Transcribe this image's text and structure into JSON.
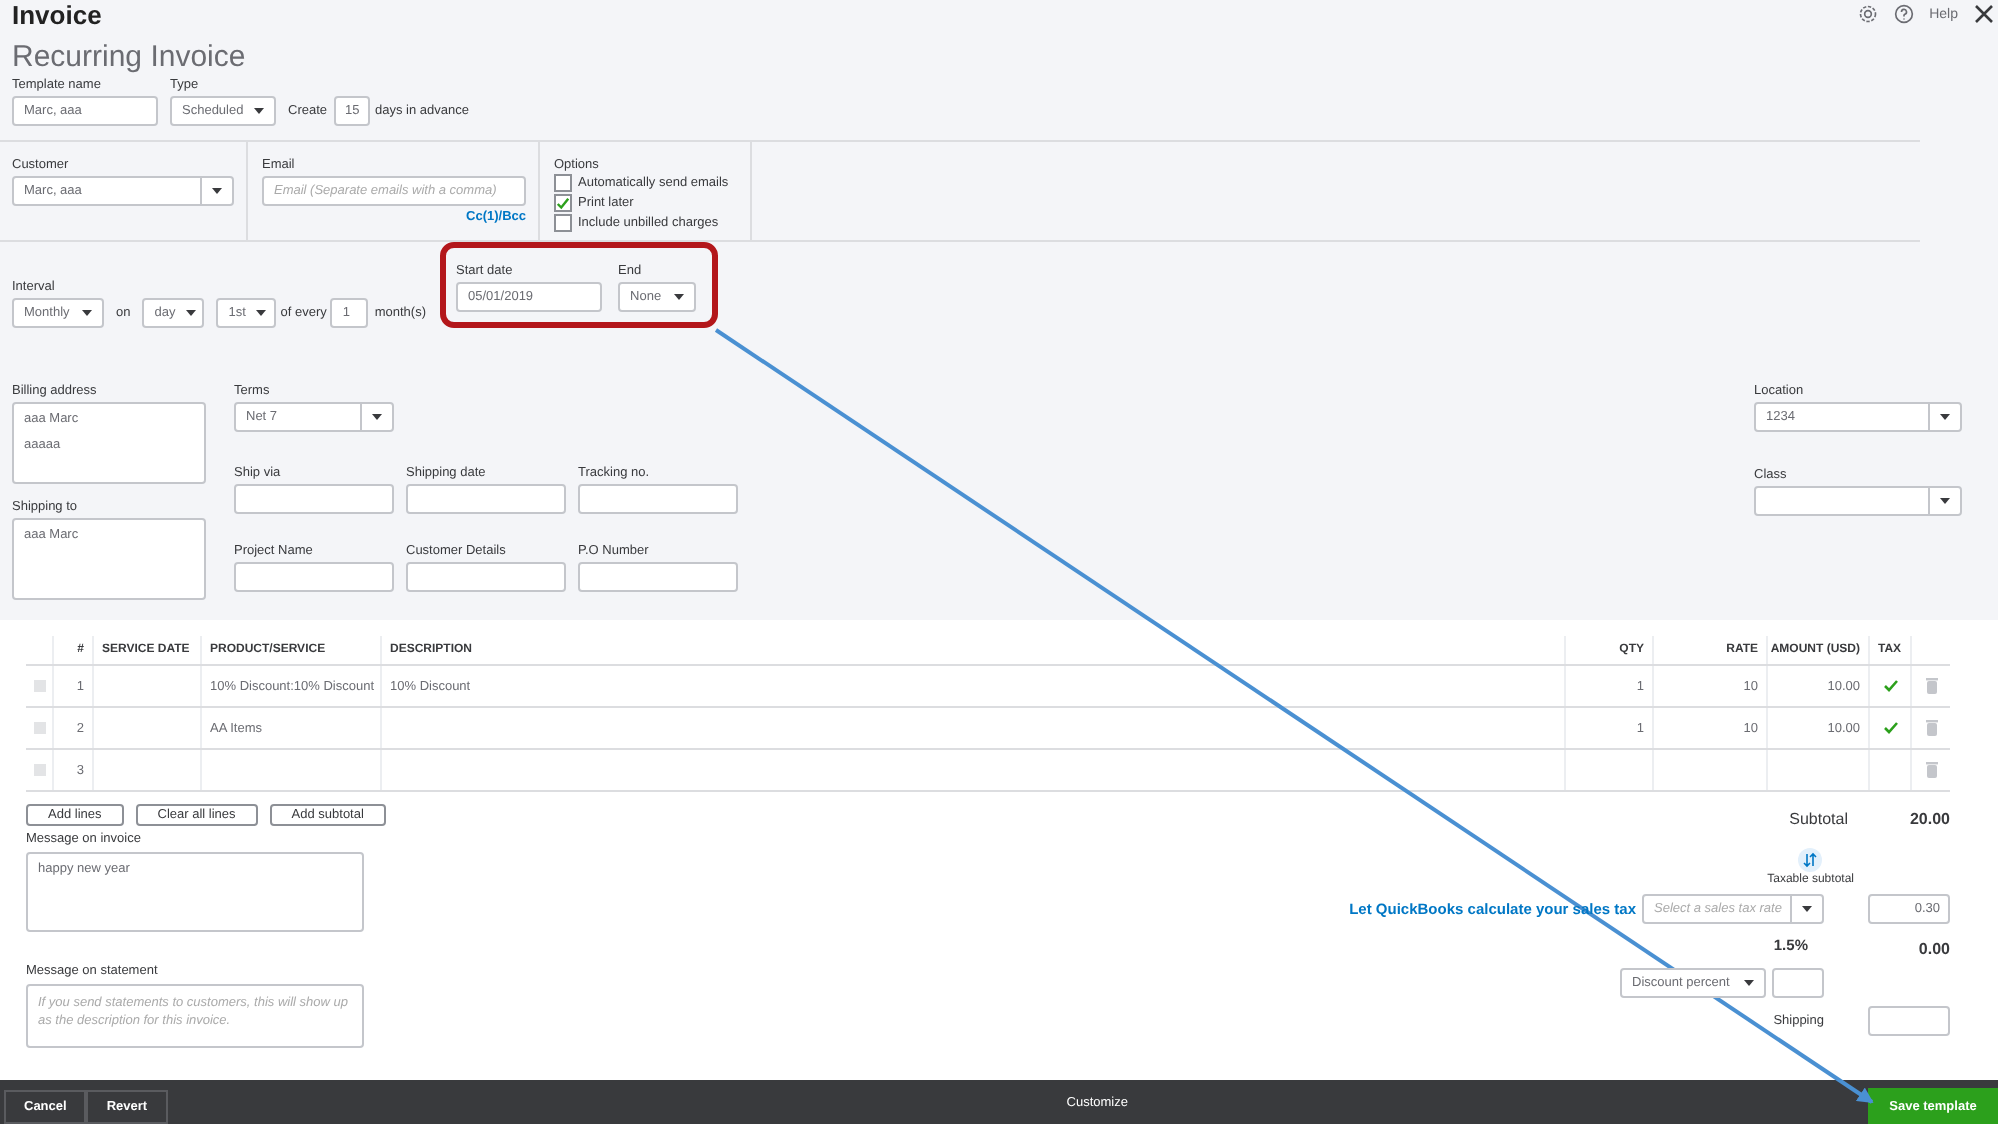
{
  "header": {
    "title": "Invoice",
    "help": "Help"
  },
  "form_title": "Recurring Invoice",
  "template": {
    "name_label": "Template name",
    "name": "Marc, aaa",
    "type_label": "Type",
    "type": "Scheduled",
    "create": "Create",
    "days": "15",
    "days_suffix": "days in advance"
  },
  "customer": {
    "label": "Customer",
    "value": "Marc, aaa"
  },
  "email": {
    "label": "Email",
    "placeholder": "Email (Separate emails with a comma)",
    "cc_link": "Cc(1)/Bcc"
  },
  "options": {
    "label": "Options",
    "items": [
      {
        "label": "Automatically send emails",
        "checked": false
      },
      {
        "label": "Print later",
        "checked": true
      },
      {
        "label": "Include unbilled charges",
        "checked": false
      }
    ]
  },
  "interval": {
    "label": "Interval",
    "frequency": "Monthly",
    "on": "on",
    "day": "day",
    "ordinal": "1st",
    "of_every": "of every",
    "count": "1",
    "unit": "month(s)"
  },
  "start_date": {
    "label": "Start date",
    "value": "05/01/2019"
  },
  "end": {
    "label": "End",
    "value": "None"
  },
  "billing_address": {
    "label": "Billing address",
    "lines": [
      "aaa Marc",
      "aaaaa"
    ]
  },
  "shipping_to": {
    "label": "Shipping to",
    "lines": [
      "aaa Marc"
    ]
  },
  "terms": {
    "label": "Terms",
    "value": "Net 7"
  },
  "fields": [
    {
      "label": "Ship via"
    },
    {
      "label": "Shipping date"
    },
    {
      "label": "Tracking no."
    },
    {
      "label": "Project Name"
    },
    {
      "label": "Customer Details"
    },
    {
      "label": "P.O Number"
    }
  ],
  "location": {
    "label": "Location",
    "value": "1234"
  },
  "class": {
    "label": "Class"
  },
  "table": {
    "columns": [
      "#",
      "SERVICE DATE",
      "PRODUCT/SERVICE",
      "DESCRIPTION",
      "QTY",
      "RATE",
      "AMOUNT (USD)",
      "TAX"
    ],
    "rows": [
      {
        "number": "1",
        "product": "10% Discount:10% Discount",
        "description": "10% Discount",
        "qty": "1",
        "rate": "10",
        "amount": "10.00",
        "taxable": true
      },
      {
        "number": "2",
        "product": "AA Items",
        "qty": "1",
        "rate": "10",
        "amount": "10.00",
        "taxable": true
      },
      {
        "number": "3",
        "taxable": false
      }
    ]
  },
  "line_buttons": [
    "Add lines",
    "Clear all lines",
    "Add subtotal"
  ],
  "message_invoice": {
    "label": "Message on invoice",
    "value": "happy new year"
  },
  "message_statement": {
    "label": "Message on statement",
    "placeholder": "If you send statements to customers, this will show up as the description for this invoice."
  },
  "totals": {
    "subtotal_label": "Subtotal",
    "subtotal": "20.00",
    "taxable_subtotal": "Taxable subtotal",
    "tax_link": "Let QuickBooks calculate your sales tax",
    "tax_rate_placeholder": "Select a sales tax rate",
    "tax_amount": "0.30",
    "tax_percent": "1.5%",
    "tax_total": "0.00",
    "discount_type": "Discount percent",
    "shipping_label": "Shipping"
  },
  "footer": {
    "cancel": "Cancel",
    "revert": "Revert",
    "customize": "Customize",
    "save": "Save template"
  }
}
